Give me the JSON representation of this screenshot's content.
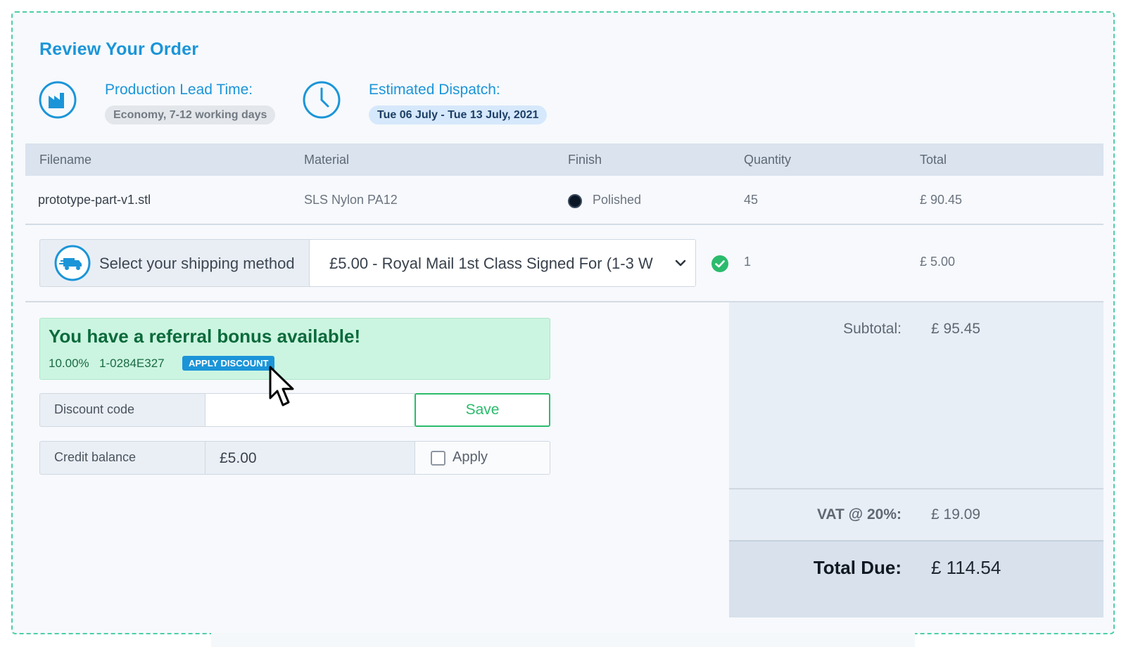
{
  "page": {
    "title": "Review Your Order"
  },
  "lead_time": {
    "label": "Production Lead Time:",
    "value": "Economy, 7-12 working days",
    "icon": "factory-icon"
  },
  "dispatch": {
    "label": "Estimated Dispatch:",
    "value": "Tue 06 July - Tue 13 July, 2021",
    "icon": "clock-icon"
  },
  "table": {
    "headers": [
      "Filename",
      "Material",
      "Finish",
      "Quantity",
      "Total"
    ],
    "rows": [
      {
        "filename": "prototype-part-v1.stl",
        "material": "SLS Nylon PA12",
        "finish": "Polished",
        "finish_color": "#0c1726",
        "quantity": "45",
        "total": "£ 90.45"
      }
    ]
  },
  "shipping": {
    "label": "Select your shipping method",
    "selected": "£5.00 - Royal Mail 1st Class Signed For (1-3 W",
    "quantity": "1",
    "total": "£ 5.00",
    "icon": "delivery-truck-icon",
    "status_icon": "check-circle-icon"
  },
  "referral": {
    "title": "You have a referral bonus available!",
    "percent": "10.00%",
    "code": "1-0284E327",
    "apply_label": "APPLY DISCOUNT"
  },
  "discount": {
    "label": "Discount code",
    "value": "",
    "save_label": "Save"
  },
  "credit": {
    "label": "Credit balance",
    "value": "£5.00",
    "apply_label": "Apply",
    "checked": false
  },
  "summary": {
    "subtotal_label": "Subtotal:",
    "subtotal": "£ 95.45",
    "vat_label": "VAT @ 20%:",
    "vat": "£ 19.09",
    "total_label": "Total Due:",
    "total": "£ 114.54"
  },
  "colors": {
    "accent": "#1b95d8",
    "success": "#2bbb6c",
    "referral_bg": "#cbf5e1",
    "border_dashed": "#4ccfa4"
  }
}
